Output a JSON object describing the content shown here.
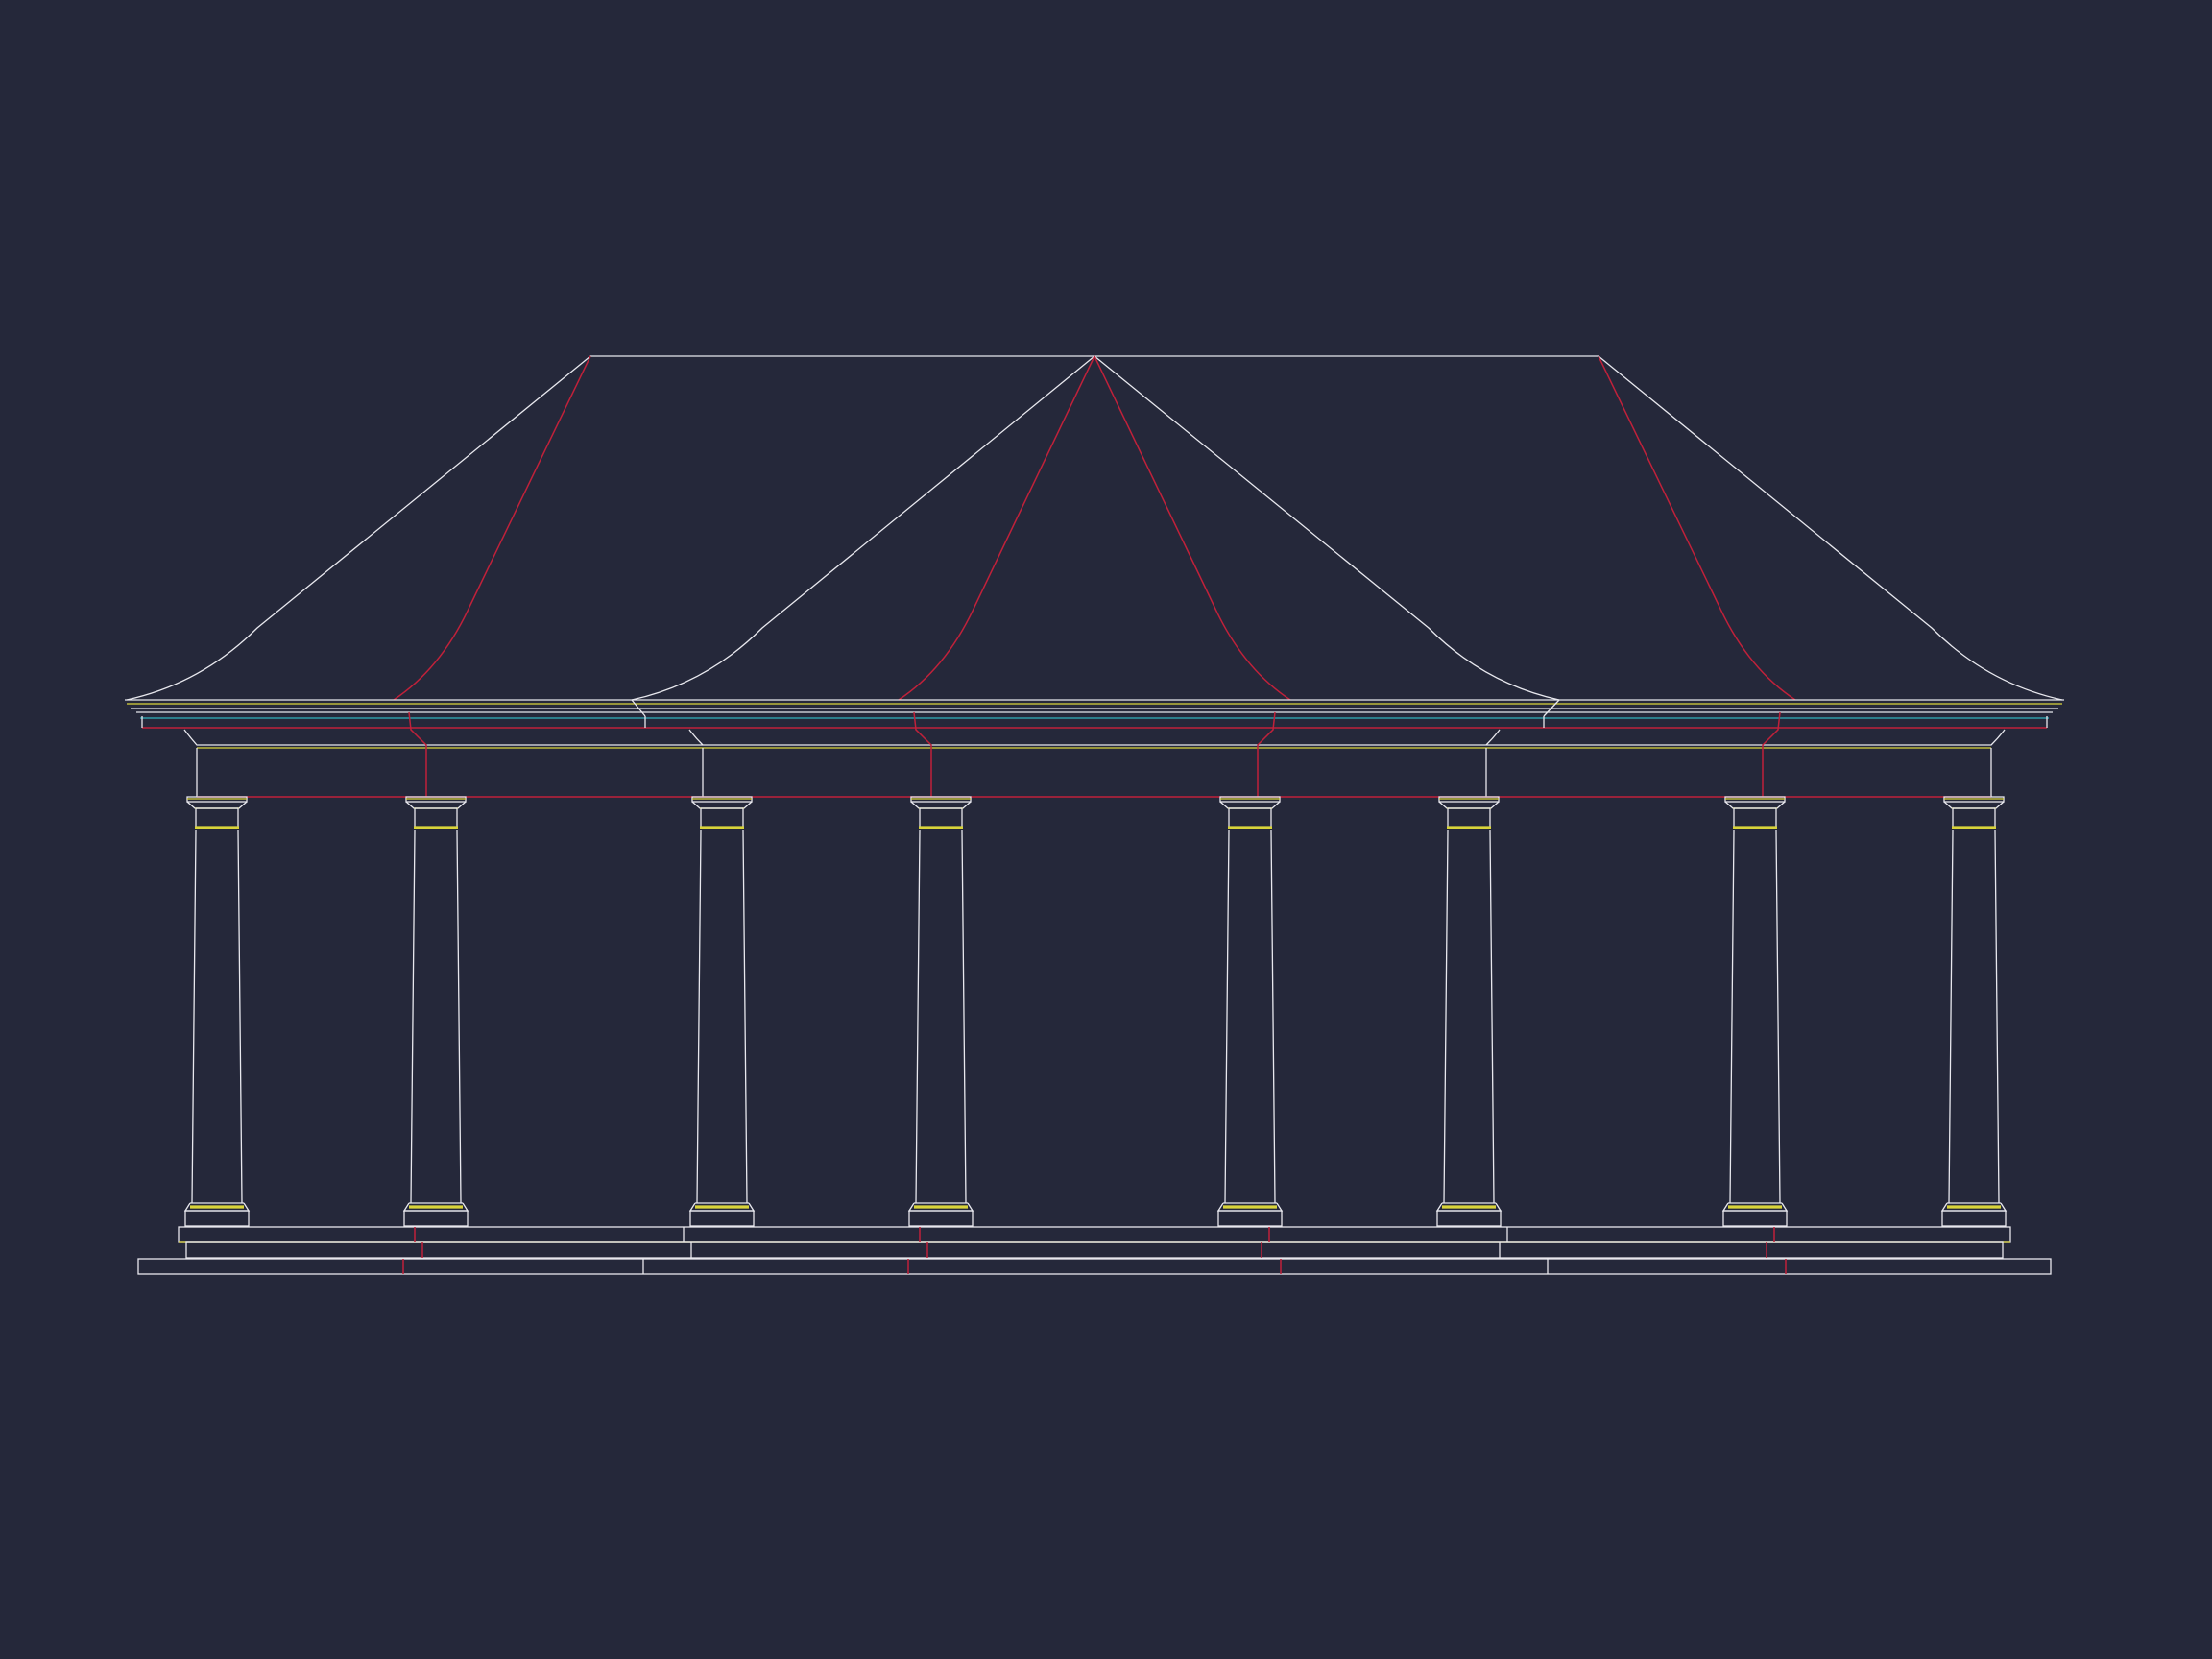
{
  "drawing": {
    "subject": "pavilion-elevation",
    "column_count": 8,
    "roof_sections": 3,
    "background_color": "#25283a",
    "colors": {
      "outline": "#e8e8ee",
      "hidden_lines": "#c0213a",
      "capital_bands": "#d9d43a",
      "fascia_line": "#2f9aa8"
    }
  }
}
